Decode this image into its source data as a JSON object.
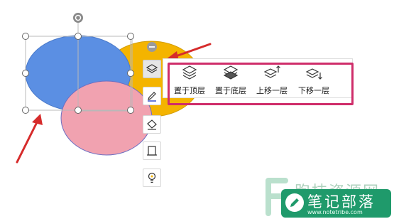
{
  "floating_toolbar": {
    "buttons": [
      {
        "name": "layer-button",
        "icon": "layers-icon",
        "active": true
      },
      {
        "name": "fill-button",
        "icon": "paint-bucket-icon",
        "active": false
      },
      {
        "name": "outline-button",
        "icon": "pen-icon",
        "active": false
      },
      {
        "name": "frame-button",
        "icon": "frame-icon",
        "active": false
      },
      {
        "name": "effects-button",
        "icon": "lightbulb-icon",
        "active": false
      }
    ]
  },
  "layer_menu": {
    "items": [
      {
        "label": "置于顶层",
        "icon": "bring-to-front-icon"
      },
      {
        "label": "置于底层",
        "icon": "send-to-back-icon"
      },
      {
        "label": "上移一层",
        "icon": "bring-forward-icon"
      },
      {
        "label": "下移一层",
        "icon": "send-backward-icon"
      }
    ]
  },
  "shapes": [
    {
      "name": "blue-ellipse",
      "fill": "#5b8fe3",
      "stroke": "#4a79c9"
    },
    {
      "name": "yellow-ellipse",
      "fill": "#f4b400",
      "stroke": "#d39c00"
    },
    {
      "name": "pink-ellipse",
      "fill": "#f1a2b0",
      "stroke": "#6c6fc2"
    }
  ],
  "colors": {
    "arrow": "#d62b2b",
    "highlight_border": "#cf2d6a",
    "watermark_green": "#1f9a6b"
  },
  "watermark": {
    "faint_text": "跑技资源网",
    "badge_title": "笔记部落",
    "badge_url": "www.notetribe.com"
  }
}
